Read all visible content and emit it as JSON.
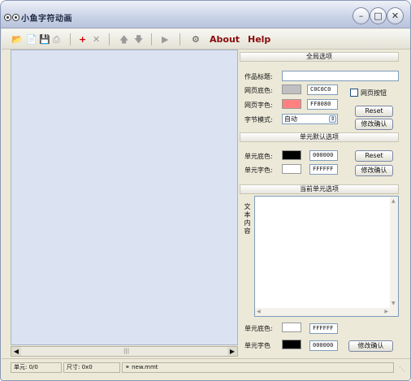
{
  "window": {
    "title": "小鱼字符动画",
    "minimize": "–",
    "maximize": "□",
    "close": "✕"
  },
  "toolbar": {
    "about_label": "About",
    "help_label": "Help"
  },
  "global_section": {
    "title": "全局选项",
    "work_title_label": "作品标题:",
    "work_title_value": "",
    "bg_color_label": "网页底色:",
    "bg_color_value": "C0C0C0",
    "bg_color_hex": "#c0c0c0",
    "text_color_label": "网页字色:",
    "text_color_value": "FF8080",
    "text_color_hex": "#ff8080",
    "page_button_label": "网页按钮",
    "encoding_label": "字节模式:",
    "encoding_value": "自动",
    "reset_label": "Reset",
    "confirm_label": "修改确认"
  },
  "default_section": {
    "title": "单元默认选项",
    "bg_label": "单元底色:",
    "bg_value": "000000",
    "bg_hex": "#000000",
    "fg_label": "单元字色:",
    "fg_value": "FFFFFF",
    "fg_hex": "#ffffff",
    "reset_label": "Reset",
    "confirm_label": "修改确认"
  },
  "current_section": {
    "title": "当前单元选项",
    "text_label": "文本内容",
    "text_value": "",
    "bg_label": "单元底色:",
    "bg_value": "FFFFFF",
    "bg_hex": "#ffffff",
    "fg_label": "单元字色",
    "fg_value": "000000",
    "fg_hex": "#000000",
    "confirm_label": "修改确认"
  },
  "status": {
    "cell_label": "单元:",
    "cell_value": "0/0",
    "size_label": "尺寸:",
    "size_value": "0x0",
    "filename": "new.mmt"
  }
}
